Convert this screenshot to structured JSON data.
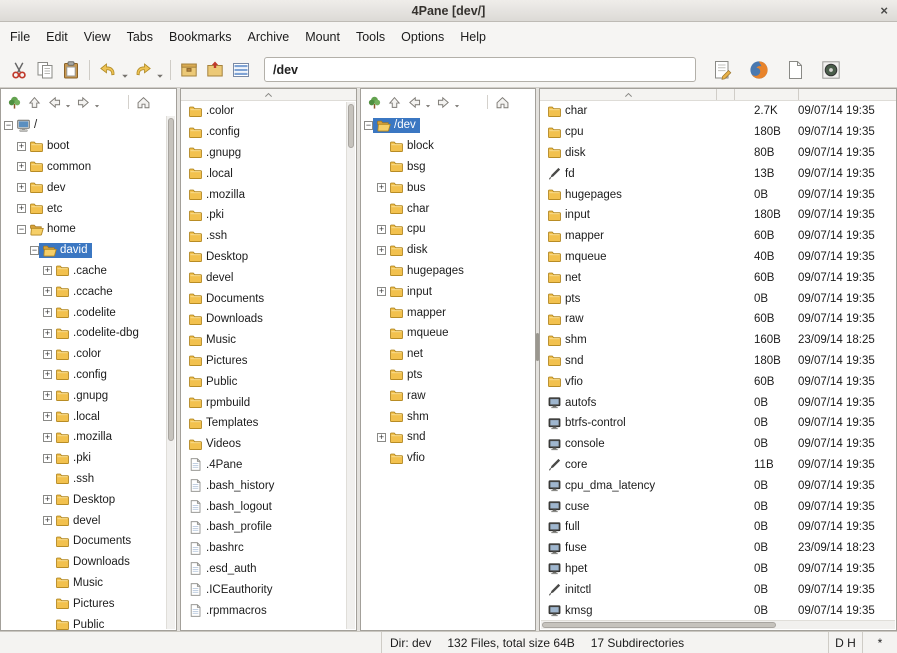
{
  "window": {
    "title": "4Pane [dev/]",
    "close": "×"
  },
  "colors": {
    "selection": "#3b77c2",
    "folder": "#f2c14e"
  },
  "menu": {
    "items": [
      "File",
      "Edit",
      "View",
      "Tabs",
      "Bookmarks",
      "Archive",
      "Mount",
      "Tools",
      "Options",
      "Help"
    ]
  },
  "toolbar": {
    "address": "/dev"
  },
  "tree_pane_left": {
    "items": [
      {
        "label": "/",
        "depth": 0,
        "icon": "computer",
        "expander": "minus"
      },
      {
        "label": "boot",
        "depth": 1,
        "icon": "folder",
        "expander": "plus"
      },
      {
        "label": "common",
        "depth": 1,
        "icon": "folder",
        "expander": "plus"
      },
      {
        "label": "dev",
        "depth": 1,
        "icon": "folder",
        "expander": "plus"
      },
      {
        "label": "etc",
        "depth": 1,
        "icon": "folder",
        "expander": "plus"
      },
      {
        "label": "home",
        "depth": 1,
        "icon": "folderOpen",
        "expander": "minus"
      },
      {
        "label": "david",
        "depth": 2,
        "icon": "folderOpen",
        "expander": "minus",
        "selected": true
      },
      {
        "label": ".cache",
        "depth": 3,
        "icon": "folder",
        "expander": "plus"
      },
      {
        "label": ".ccache",
        "depth": 3,
        "icon": "folder",
        "expander": "plus"
      },
      {
        "label": ".codelite",
        "depth": 3,
        "icon": "folder",
        "expander": "plus"
      },
      {
        "label": ".codelite-dbg",
        "depth": 3,
        "icon": "folder",
        "expander": "plus"
      },
      {
        "label": ".color",
        "depth": 3,
        "icon": "folder",
        "expander": "plus"
      },
      {
        "label": ".config",
        "depth": 3,
        "icon": "folder",
        "expander": "plus"
      },
      {
        "label": ".gnupg",
        "depth": 3,
        "icon": "folder",
        "expander": "plus"
      },
      {
        "label": ".local",
        "depth": 3,
        "icon": "folder",
        "expander": "plus"
      },
      {
        "label": ".mozilla",
        "depth": 3,
        "icon": "folder",
        "expander": "plus"
      },
      {
        "label": ".pki",
        "depth": 3,
        "icon": "folder",
        "expander": "plus"
      },
      {
        "label": ".ssh",
        "depth": 3,
        "icon": "folder",
        "expander": "none"
      },
      {
        "label": "Desktop",
        "depth": 3,
        "icon": "folder",
        "expander": "plus"
      },
      {
        "label": "devel",
        "depth": 3,
        "icon": "folder",
        "expander": "plus"
      },
      {
        "label": "Documents",
        "depth": 3,
        "icon": "folder",
        "expander": "none"
      },
      {
        "label": "Downloads",
        "depth": 3,
        "icon": "folder",
        "expander": "none"
      },
      {
        "label": "Music",
        "depth": 3,
        "icon": "folder",
        "expander": "none"
      },
      {
        "label": "Pictures",
        "depth": 3,
        "icon": "folder",
        "expander": "none"
      },
      {
        "label": "Public",
        "depth": 3,
        "icon": "folder",
        "expander": "none"
      }
    ]
  },
  "file_pane_left": {
    "items": [
      {
        "label": ".color",
        "icon": "folder"
      },
      {
        "label": ".config",
        "icon": "folder"
      },
      {
        "label": ".gnupg",
        "icon": "folder"
      },
      {
        "label": ".local",
        "icon": "folder"
      },
      {
        "label": ".mozilla",
        "icon": "folder"
      },
      {
        "label": ".pki",
        "icon": "folder"
      },
      {
        "label": ".ssh",
        "icon": "folder"
      },
      {
        "label": "Desktop",
        "icon": "folder"
      },
      {
        "label": "devel",
        "icon": "folder"
      },
      {
        "label": "Documents",
        "icon": "folder"
      },
      {
        "label": "Downloads",
        "icon": "folder"
      },
      {
        "label": "Music",
        "icon": "folder"
      },
      {
        "label": "Pictures",
        "icon": "folder"
      },
      {
        "label": "Public",
        "icon": "folder"
      },
      {
        "label": "rpmbuild",
        "icon": "folder"
      },
      {
        "label": "Templates",
        "icon": "folder"
      },
      {
        "label": "Videos",
        "icon": "folder"
      },
      {
        "label": ".4Pane",
        "icon": "file"
      },
      {
        "label": ".bash_history",
        "icon": "file"
      },
      {
        "label": ".bash_logout",
        "icon": "file"
      },
      {
        "label": ".bash_profile",
        "icon": "file"
      },
      {
        "label": ".bashrc",
        "icon": "file"
      },
      {
        "label": ".esd_auth",
        "icon": "file"
      },
      {
        "label": ".ICEauthority",
        "icon": "file"
      },
      {
        "label": ".rpmmacros",
        "icon": "file"
      }
    ]
  },
  "tree_pane_right": {
    "items": [
      {
        "label": "/dev",
        "depth": 0,
        "icon": "folderOpen",
        "expander": "minus",
        "selected": true
      },
      {
        "label": "block",
        "depth": 1,
        "icon": "folder",
        "expander": "none"
      },
      {
        "label": "bsg",
        "depth": 1,
        "icon": "folder",
        "expander": "none"
      },
      {
        "label": "bus",
        "depth": 1,
        "icon": "folder",
        "expander": "plus"
      },
      {
        "label": "char",
        "depth": 1,
        "icon": "folder",
        "expander": "none"
      },
      {
        "label": "cpu",
        "depth": 1,
        "icon": "folder",
        "expander": "plus"
      },
      {
        "label": "disk",
        "depth": 1,
        "icon": "folder",
        "expander": "plus"
      },
      {
        "label": "hugepages",
        "depth": 1,
        "icon": "folder",
        "expander": "none"
      },
      {
        "label": "input",
        "depth": 1,
        "icon": "folder",
        "expander": "plus"
      },
      {
        "label": "mapper",
        "depth": 1,
        "icon": "folder",
        "expander": "none"
      },
      {
        "label": "mqueue",
        "depth": 1,
        "icon": "folder",
        "expander": "none"
      },
      {
        "label": "net",
        "depth": 1,
        "icon": "folder",
        "expander": "none"
      },
      {
        "label": "pts",
        "depth": 1,
        "icon": "folder",
        "expander": "none"
      },
      {
        "label": "raw",
        "depth": 1,
        "icon": "folder",
        "expander": "none"
      },
      {
        "label": "shm",
        "depth": 1,
        "icon": "folder",
        "expander": "none"
      },
      {
        "label": "snd",
        "depth": 1,
        "icon": "folder",
        "expander": "plus"
      },
      {
        "label": "vfio",
        "depth": 1,
        "icon": "folder",
        "expander": "none"
      }
    ]
  },
  "file_pane_right": {
    "rows": [
      {
        "name": "char",
        "icon": "folder",
        "size": "2.7K",
        "date": "09/07/14 19:35"
      },
      {
        "name": "cpu",
        "icon": "folder",
        "size": "180B",
        "date": "09/07/14 19:35"
      },
      {
        "name": "disk",
        "icon": "folder",
        "size": "80B",
        "date": "09/07/14 19:35"
      },
      {
        "name": "fd",
        "icon": "symlink",
        "size": "13B",
        "date": "09/07/14 19:35"
      },
      {
        "name": "hugepages",
        "icon": "folder",
        "size": "0B",
        "date": "09/07/14 19:35"
      },
      {
        "name": "input",
        "icon": "folder",
        "size": "180B",
        "date": "09/07/14 19:35"
      },
      {
        "name": "mapper",
        "icon": "folder",
        "size": "60B",
        "date": "09/07/14 19:35"
      },
      {
        "name": "mqueue",
        "icon": "folder",
        "size": "40B",
        "date": "09/07/14 19:35"
      },
      {
        "name": "net",
        "icon": "folder",
        "size": "60B",
        "date": "09/07/14 19:35"
      },
      {
        "name": "pts",
        "icon": "folder",
        "size": "0B",
        "date": "09/07/14 19:35"
      },
      {
        "name": "raw",
        "icon": "folder",
        "size": "60B",
        "date": "09/07/14 19:35"
      },
      {
        "name": "shm",
        "icon": "folder",
        "size": "160B",
        "date": "23/09/14 18:25"
      },
      {
        "name": "snd",
        "icon": "folder",
        "size": "180B",
        "date": "09/07/14 19:35"
      },
      {
        "name": "vfio",
        "icon": "folder",
        "size": "60B",
        "date": "09/07/14 19:35"
      },
      {
        "name": "autofs",
        "icon": "device",
        "size": "0B",
        "date": "09/07/14 19:35"
      },
      {
        "name": "btrfs-control",
        "icon": "device",
        "size": "0B",
        "date": "09/07/14 19:35"
      },
      {
        "name": "console",
        "icon": "device",
        "size": "0B",
        "date": "09/07/14 19:35"
      },
      {
        "name": "core",
        "icon": "symlink",
        "size": "11B",
        "date": "09/07/14 19:35"
      },
      {
        "name": "cpu_dma_latency",
        "icon": "device",
        "size": "0B",
        "date": "09/07/14 19:35"
      },
      {
        "name": "cuse",
        "icon": "device",
        "size": "0B",
        "date": "09/07/14 19:35"
      },
      {
        "name": "full",
        "icon": "device",
        "size": "0B",
        "date": "09/07/14 19:35"
      },
      {
        "name": "fuse",
        "icon": "device",
        "size": "0B",
        "date": "23/09/14 18:23"
      },
      {
        "name": "hpet",
        "icon": "device",
        "size": "0B",
        "date": "09/07/14 19:35"
      },
      {
        "name": "initctl",
        "icon": "symlink",
        "size": "0B",
        "date": "09/07/14 19:35"
      },
      {
        "name": "kmsg",
        "icon": "device",
        "size": "0B",
        "date": "09/07/14 19:35"
      }
    ]
  },
  "statusbar": {
    "dir": "Dir: dev",
    "files": "132 Files, total size 64B",
    "subdirs": "17 Subdirectories",
    "flags": "D H",
    "star": "*"
  }
}
